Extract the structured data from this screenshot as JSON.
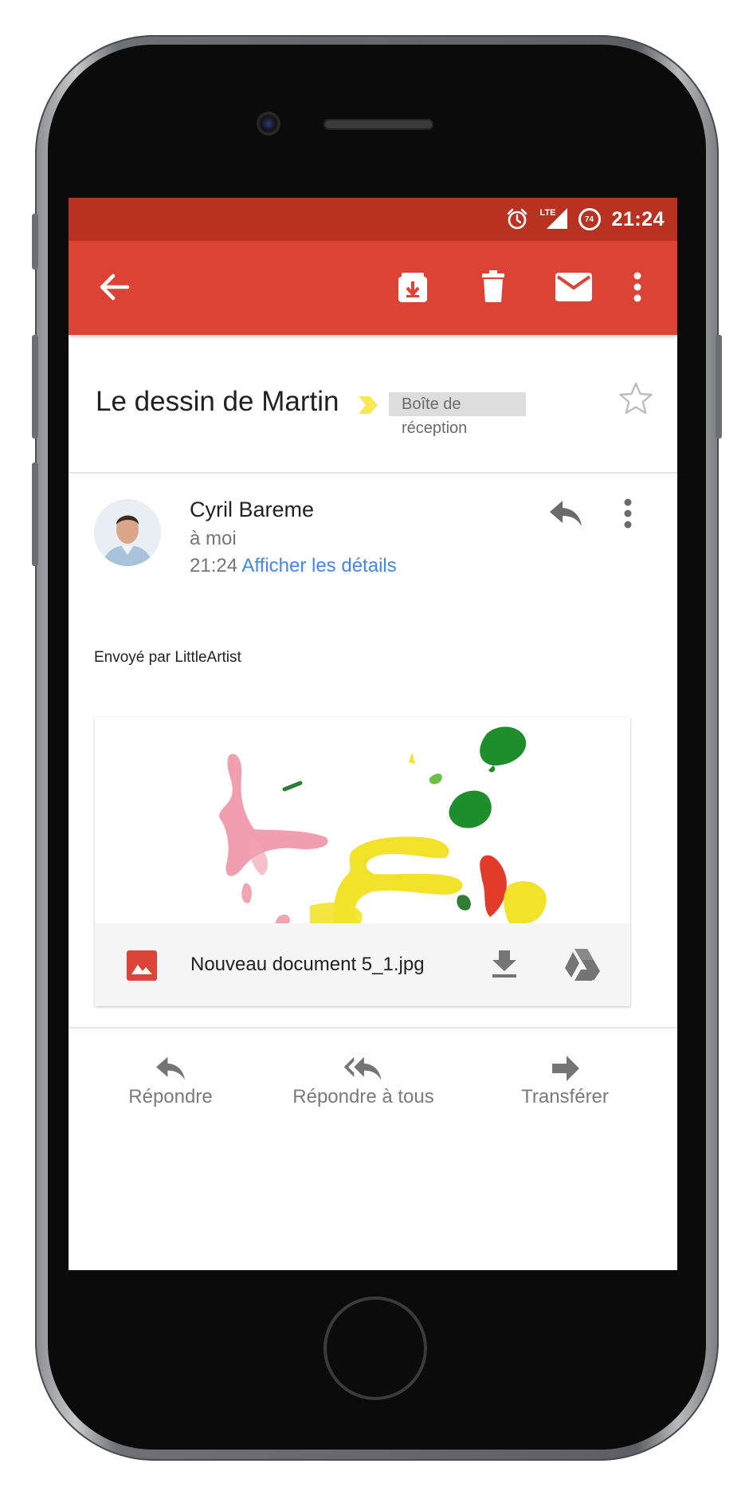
{
  "status_bar": {
    "time": "21:24",
    "network": "LTE",
    "battery": "74"
  },
  "toolbar": {
    "back": "arrow-back-icon",
    "archive": "archive-icon",
    "delete": "delete-icon",
    "mark_unread": "mail-icon",
    "more": "more-vert-icon"
  },
  "email": {
    "subject": "Le dessin de Martin",
    "label": "Boîte de réception",
    "sender_name": "Cyril Bareme",
    "recipient": "à moi",
    "time": "21:24",
    "details_link": "Afficher les détails",
    "body": "Envoyé par LittleArtist",
    "attachment": {
      "file_name": "Nouveau document 5_1.jpg"
    }
  },
  "actions": {
    "reply": "Répondre",
    "reply_all": "Répondre à tous",
    "forward": "Transférer"
  },
  "colors": {
    "status_bar": "#b93221",
    "toolbar": "#dc4335",
    "link": "#4285f4",
    "label_chip": "#dddddd"
  }
}
